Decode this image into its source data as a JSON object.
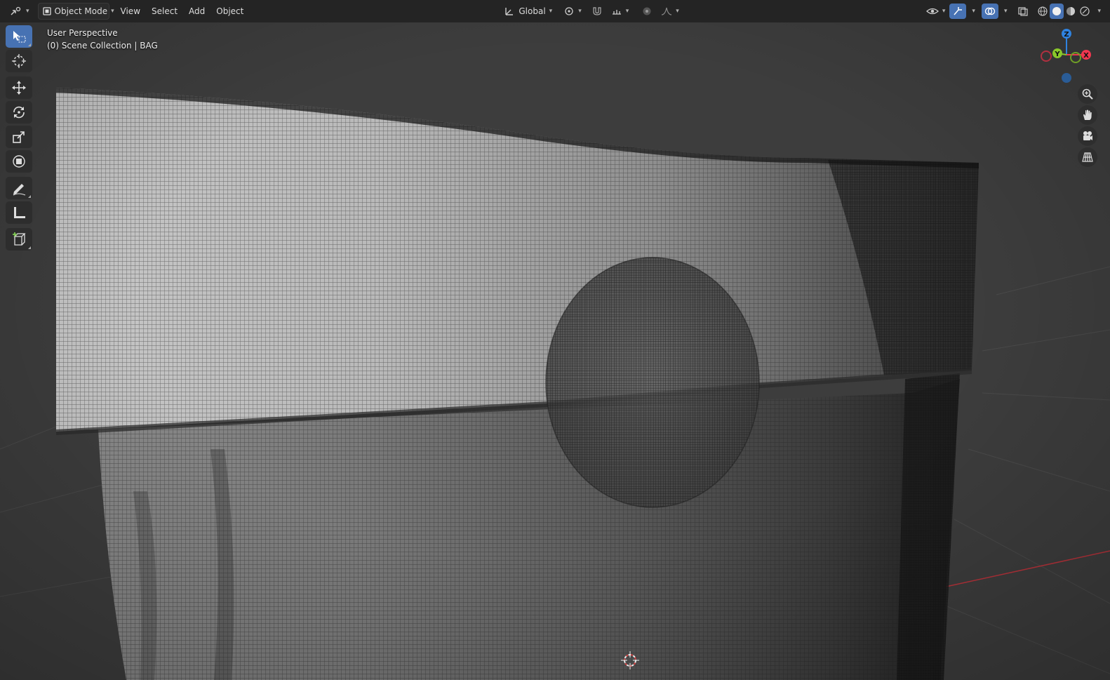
{
  "header": {
    "mode": "Object Mode",
    "menus": [
      "View",
      "Select",
      "Add",
      "Object"
    ],
    "orientation": "Global"
  },
  "overlay": {
    "view_name": "User Perspective",
    "collection_info": "(0) Scene Collection | BAG"
  },
  "gizmo": {
    "z_label": "Z",
    "y_label": "Y",
    "x_label": "X"
  },
  "toolbar": {
    "active_tool": "select-box",
    "tools": [
      "select-box",
      "cursor",
      "move",
      "rotate",
      "scale",
      "transform",
      "annotate",
      "measure",
      "add-cube"
    ]
  },
  "colors": {
    "active_tool": "#4772b3",
    "viewport_bg": "#3d3d3d",
    "axis_x": "#f0374f",
    "axis_y": "#8ac82a",
    "axis_z": "#2f83e0",
    "x_axis_line": "#b9333b"
  }
}
